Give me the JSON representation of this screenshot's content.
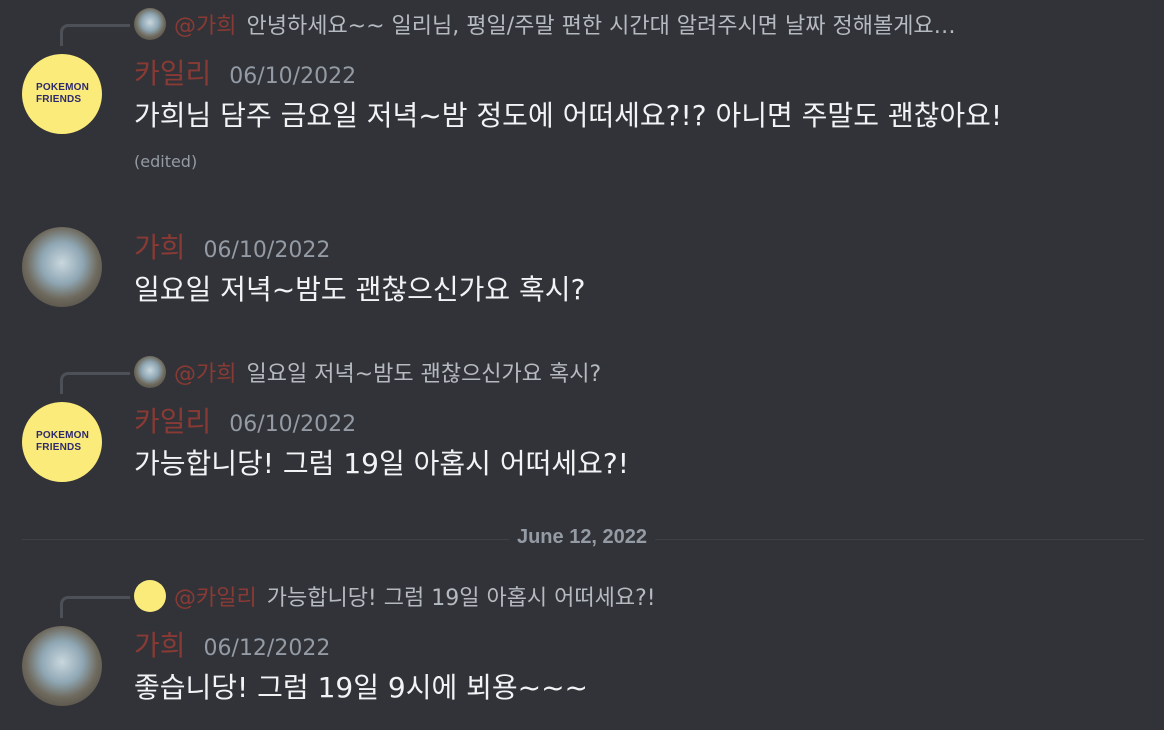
{
  "messages": [
    {
      "reply": {
        "mention": "@가희",
        "text": "안녕하세요~~ 일리님, 평일/주말 편한 시간대 알려주시면 날짜 정해볼게요…"
      },
      "author": "카일리",
      "timestamp": "06/10/2022",
      "content": "가희님 담주 금요일 저녁~밤 정도에 어떠세요?!? 아니면 주말도 괜찮아요!",
      "edited": "(edited)",
      "avatar_text": [
        "POKEMON",
        "FRIENDS"
      ]
    },
    {
      "author": "가희",
      "timestamp": "06/10/2022",
      "content": "일요일 저녁~밤도 괜찮으신가요 혹시?"
    },
    {
      "reply": {
        "mention": "@가희",
        "text": "일요일 저녁~밤도 괜찮으신가요 혹시?"
      },
      "author": "카일리",
      "timestamp": "06/10/2022",
      "content": "가능합니당! 그럼 19일 아홉시 어떠세요?!",
      "avatar_text": [
        "POKEMON",
        "FRIENDS"
      ]
    },
    {
      "reply": {
        "mention": "@카일리",
        "text": "가능합니당! 그럼 19일 아홉시 어떠세요?!"
      },
      "author": "가희",
      "timestamp": "06/12/2022",
      "content": "좋습니당! 그럼 19일 9시에 뵈용~~~"
    }
  ],
  "date_divider": "June 12, 2022",
  "colors": {
    "background": "#313338",
    "username": "#8a3a34",
    "text": "#f2f3f5",
    "muted": "#949ba4",
    "pokemon_avatar": "#fbeb7a"
  }
}
